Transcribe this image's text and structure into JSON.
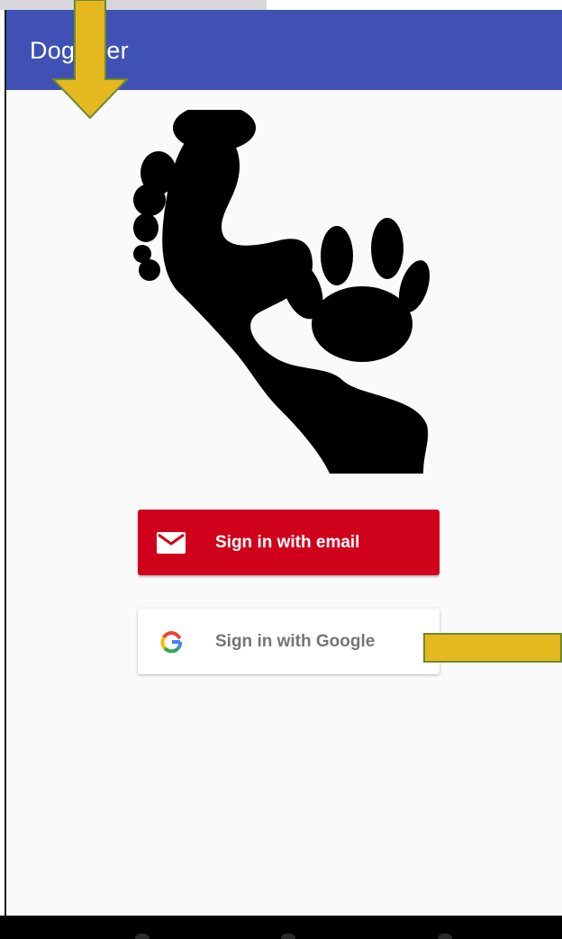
{
  "app": {
    "title": "Dogsitter"
  },
  "auth": {
    "email_button_label": "Sign in with email",
    "google_button_label": "Sign in with Google"
  },
  "icons": {
    "logo": "footprint-paw-logo-icon",
    "email": "mail-envelope-icon",
    "google": "google-g-icon"
  },
  "colors": {
    "appbar": "#3f51b5",
    "email_button": "#d0021b",
    "google_button": "#ffffff",
    "annotation_arrow": "#e6b820"
  }
}
